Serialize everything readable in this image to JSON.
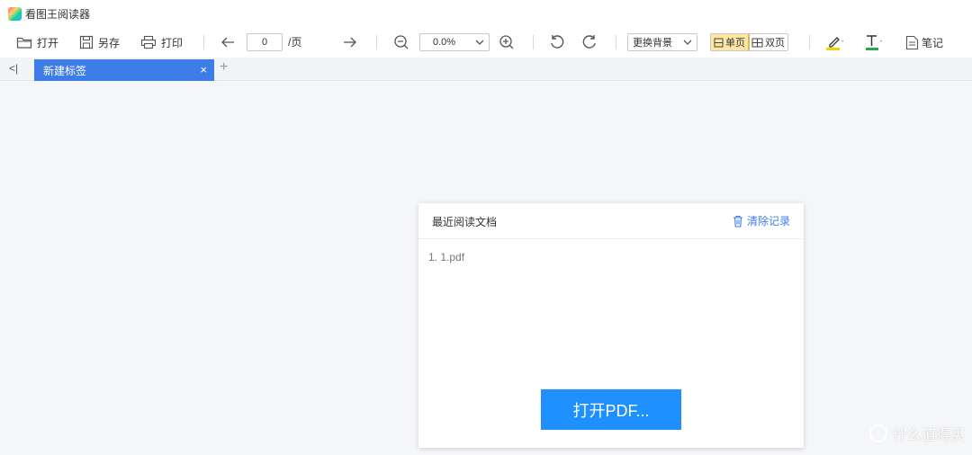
{
  "app": {
    "title": "看图王阅读器"
  },
  "toolbar": {
    "open_label": "打开",
    "save_as_label": "另存",
    "print_label": "打印",
    "page_value": "0",
    "page_suffix": "/页",
    "zoom_value": "0.0%",
    "background_label": "更换背景",
    "single_page_label": "单页",
    "double_page_label": "双页",
    "notes_label": "笔记",
    "highlight_color": "#f5d300",
    "text_color": "#2ea44f"
  },
  "tabs": {
    "items": [
      {
        "label": "新建标签",
        "active": true
      }
    ],
    "accent": "#3e7de8"
  },
  "recent": {
    "title": "最近阅读文档",
    "clear_label": "清除记录",
    "items": [
      "1. 1.pdf"
    ],
    "open_button_label": "打开PDF..."
  },
  "watermark": {
    "text": "什么值得买",
    "logo_text": "值"
  }
}
